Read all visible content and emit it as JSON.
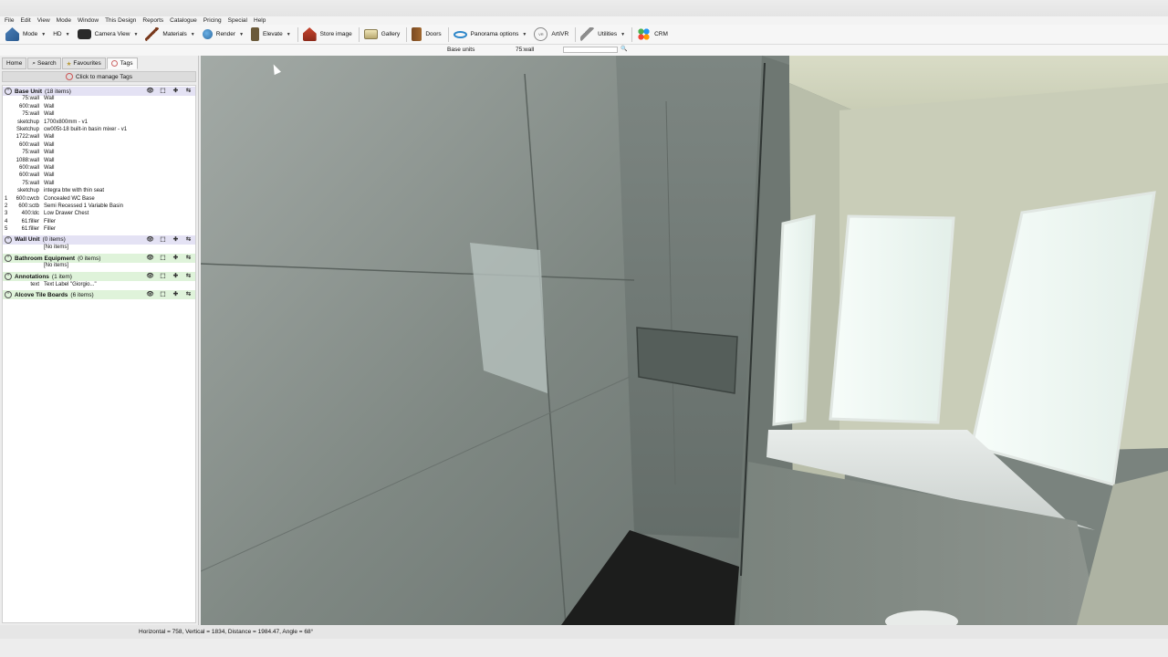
{
  "menu": [
    "File",
    "Edit",
    "View",
    "Mode",
    "Window",
    "This Design",
    "Reports",
    "Catalogue",
    "Pricing",
    "Special",
    "Help"
  ],
  "toolbar": {
    "mode": "Mode",
    "hd": "HD",
    "camera_view": "Camera View",
    "materials": "Materials",
    "render": "Render",
    "elevate": "Elevate",
    "store_image": "Store image",
    "gallery": "Gallery",
    "doors": "Doors",
    "panorama": "Panorama options",
    "artivr": "ArtiVR",
    "artivr_badge": "VR",
    "utilities": "Utilities",
    "crm": "CRM"
  },
  "subbar": {
    "base_units_label": "Base units",
    "base_units_value": "75:wall"
  },
  "tabs": [
    "Home",
    "Search",
    "Favourites",
    "Tags"
  ],
  "manage_tags": "Click to manage Tags",
  "tree": {
    "base_unit": {
      "title": "Base Unit",
      "count": "(18 items)",
      "rows": [
        {
          "n": "",
          "code": "75:wall",
          "desc": "Wall"
        },
        {
          "n": "",
          "code": "600:wall",
          "desc": "Wall"
        },
        {
          "n": "",
          "code": "75:wall",
          "desc": "Wall"
        },
        {
          "n": "",
          "code": "sketchup",
          "desc": "1700x800mm - v1"
        },
        {
          "n": "",
          "code": "Sketchup",
          "desc": "cw005t-18 built-in basin mixer - v1"
        },
        {
          "n": "",
          "code": "1722:wall",
          "desc": "Wall"
        },
        {
          "n": "",
          "code": "600:wall",
          "desc": "Wall"
        },
        {
          "n": "",
          "code": "75:wall",
          "desc": "Wall"
        },
        {
          "n": "",
          "code": "1088:wall",
          "desc": "Wall"
        },
        {
          "n": "",
          "code": "600:wall",
          "desc": "Wall"
        },
        {
          "n": "",
          "code": "600:wall",
          "desc": "Wall"
        },
        {
          "n": "",
          "code": "75:wall",
          "desc": "Wall"
        },
        {
          "n": "",
          "code": "sketchup",
          "desc": "integra btw with thin seat"
        },
        {
          "n": "1",
          "code": "600:cwcb",
          "desc": "Concealed WC Base"
        },
        {
          "n": "2",
          "code": "600:sctb",
          "desc": "Semi Recessed 1 Variable Basin"
        },
        {
          "n": "3",
          "code": "400:ldc",
          "desc": "Low Drawer Chest"
        },
        {
          "n": "4",
          "code": "61:filler",
          "desc": "Filler"
        },
        {
          "n": "5",
          "code": "61:filler",
          "desc": "Filler"
        }
      ]
    },
    "wall_unit": {
      "title": "Wall Unit",
      "count": "(0 items)",
      "empty": "[No items]"
    },
    "bathroom_equipment": {
      "title": "Bathroom Equipment",
      "count": "(0 items)",
      "empty": "[No items]"
    },
    "annotations": {
      "title": "Annotations",
      "count": "(1 item)",
      "rows": [
        {
          "n": "",
          "code": "text",
          "desc": "Text Label \"Giorgio...\""
        }
      ]
    },
    "alcove_tile_boards": {
      "title": "Alcove Tile Boards",
      "count": "(6 items)"
    }
  },
  "status": "Horizontal = 758, Vertical = 1834, Distance = 1984.47, Angle = 68°",
  "colors": {
    "group_purple": "#e4e2f4",
    "group_green": "#dff3da",
    "tile": "#8e9793",
    "tile_dark": "#5f6864",
    "window_glow": "#f4fbf7",
    "shower_tray": "#1c1d1c"
  }
}
